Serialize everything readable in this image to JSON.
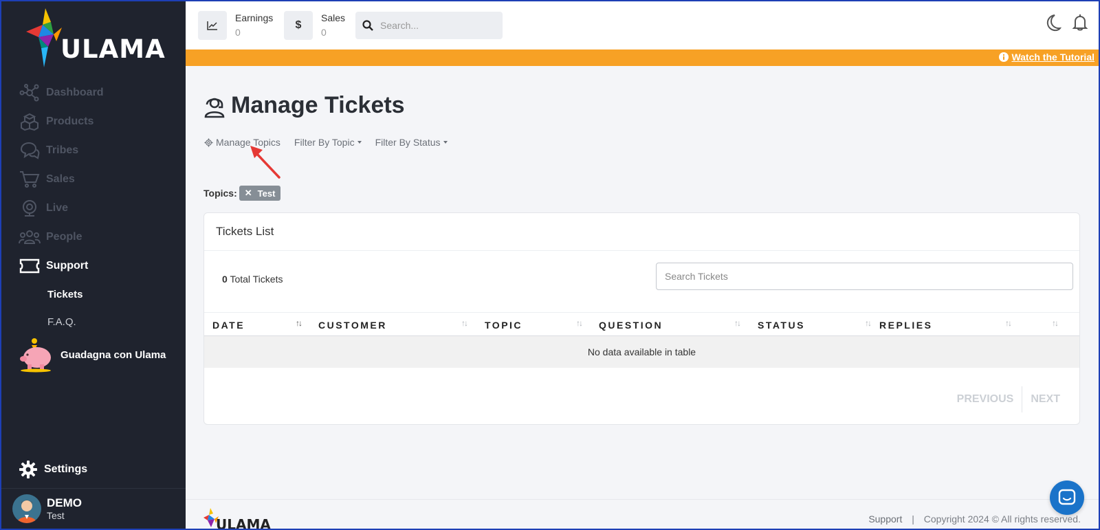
{
  "brand": {
    "name": "ULAMA"
  },
  "sidebar": {
    "items": [
      {
        "label": "Dashboard",
        "icon": "network-icon"
      },
      {
        "label": "Products",
        "icon": "boxes-icon"
      },
      {
        "label": "Tribes",
        "icon": "chat-bubbles-icon"
      },
      {
        "label": "Sales",
        "icon": "cart-icon"
      },
      {
        "label": "Live",
        "icon": "webcam-icon"
      },
      {
        "label": "People",
        "icon": "users-icon"
      },
      {
        "label": "Support",
        "icon": "ticket-icon"
      }
    ],
    "sub_items": [
      {
        "label": "Tickets"
      },
      {
        "label": "F.A.Q."
      }
    ],
    "promo": {
      "label": "Guadagna con Ulama"
    },
    "settings": {
      "label": "Settings"
    },
    "user": {
      "name": "DEMO",
      "role": "Test"
    }
  },
  "topbar": {
    "earnings": {
      "label": "Earnings",
      "value": "0"
    },
    "sales": {
      "label": "Sales",
      "value": "0",
      "icon_text": "$"
    },
    "search": {
      "placeholder": "Search..."
    }
  },
  "banner": {
    "tutorial_label": "Watch the Tutorial"
  },
  "page": {
    "title": "Manage Tickets",
    "toolbar": {
      "manage_topics": "Manage Topics",
      "filter_topic": "Filter By Topic",
      "filter_status": "Filter By Status"
    },
    "topics": {
      "label": "Topics:",
      "chips": [
        {
          "label": "Test"
        }
      ]
    }
  },
  "tickets": {
    "card_title": "Tickets List",
    "total_count": "0",
    "total_label": "Total Tickets",
    "search_placeholder": "Search Tickets",
    "columns": [
      "DATE",
      "CUSTOMER",
      "TOPIC",
      "QUESTION",
      "STATUS",
      "REPLIES"
    ],
    "empty_text": "No data available in table",
    "pagination": {
      "previous": "PREVIOUS",
      "next": "NEXT"
    }
  },
  "footer": {
    "support": "Support",
    "separator": "|",
    "copyright": "Copyright 2024 © All rights reserved."
  },
  "colors": {
    "sidebar_bg": "#1f232e",
    "banner": "#f7a125",
    "chat_button": "#1a73c9"
  }
}
